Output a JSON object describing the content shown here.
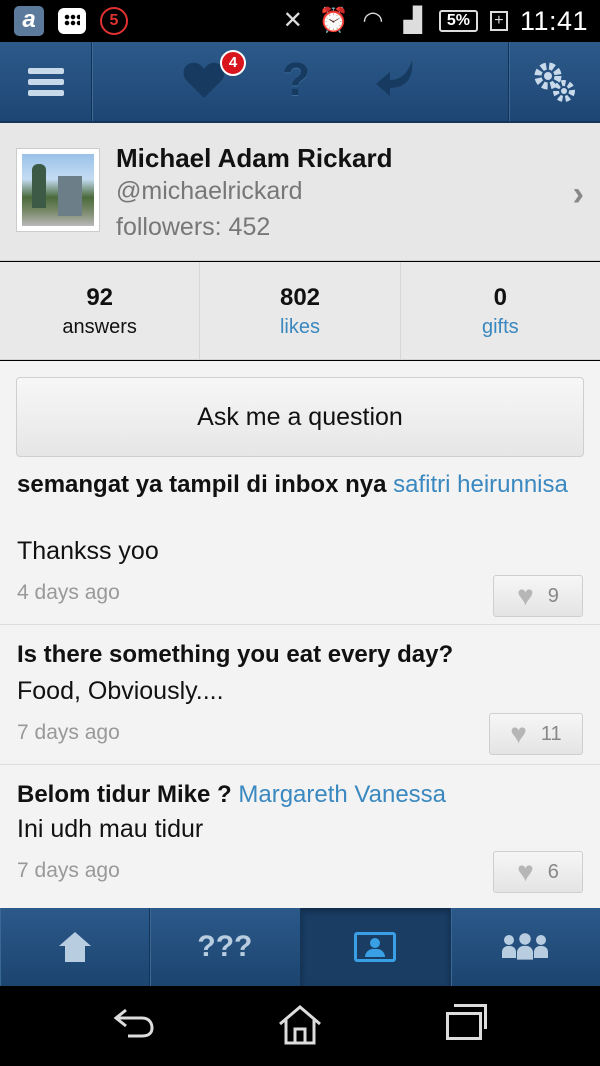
{
  "status_bar": {
    "app_letter": "a",
    "notification_count": "5",
    "battery": "5%",
    "time": "11:41"
  },
  "top_bar": {
    "notification_badge": "4",
    "question_glyph": "?",
    "icons": [
      "menu-icon",
      "heart-icon",
      "question-icon",
      "reply-icon",
      "gear-icon"
    ]
  },
  "profile": {
    "name": "Michael Adam Rickard",
    "handle": "@michaelrickard",
    "followers": "followers: 452"
  },
  "stats": [
    {
      "value": "92",
      "label": "answers"
    },
    {
      "value": "802",
      "label": "likes"
    },
    {
      "value": "0",
      "label": "gifts"
    }
  ],
  "ask_button": "Ask me a question",
  "feed": [
    {
      "question": "semangat ya tampil di inbox nya",
      "asker": "safitri heirunnisa",
      "answer": "Thankss yoo",
      "time": "4 days ago",
      "likes": "9"
    },
    {
      "question": "Is there something you eat every day?",
      "asker": "",
      "answer": "Food, Obviously....",
      "time": "7 days ago",
      "likes": "11"
    },
    {
      "question": "Belom tidur Mike ?",
      "asker": "Margareth Vanessa",
      "answer": "Ini udh mau tidur",
      "time": "7 days ago",
      "likes": "6"
    }
  ],
  "bottom_tabs": {
    "questions_label": "???",
    "icons": [
      "home-icon",
      "questions-icon",
      "profile-icon",
      "friends-icon"
    ],
    "active": "profile-icon"
  },
  "colors": {
    "bar_blue": "#24507f",
    "link_blue": "#3a88c0",
    "badge_red": "#d8151c"
  }
}
